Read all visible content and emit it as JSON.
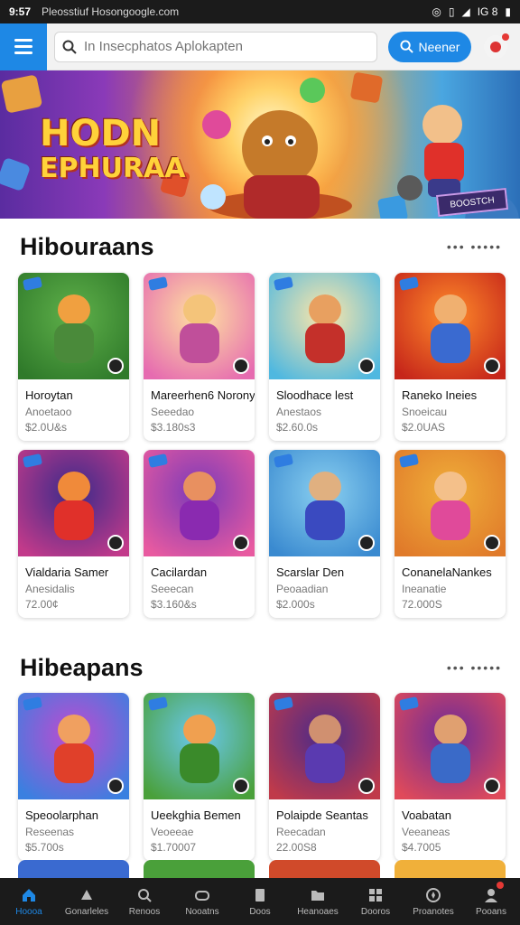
{
  "status_bar": {
    "time": "9:57",
    "url": "Pleosstiuf Hosongoogle.com",
    "indicators": "IG 8"
  },
  "top_bar": {
    "search_placeholder": "In Insecphatos Aplokapten",
    "search_button_label": "Neener"
  },
  "hero": {
    "title_line1": "HODN",
    "title_line2": "EPHURAA",
    "sign_text": "BOOSTCH"
  },
  "sections": [
    {
      "title": "Hibouraans",
      "more": "••• •••••",
      "cards": [
        {
          "title": "Horoytan",
          "subtitle": "Anoetaoo",
          "price": "$2.0U&s",
          "colors": [
            "#5fb04a",
            "#2f7a2a",
            "#f0a040",
            "#4a8a3a"
          ]
        },
        {
          "title": "Mareerhen6 Norony",
          "subtitle": "Seeedao",
          "price": "$3.180s3",
          "colors": [
            "#ffe3a0",
            "#e66bb0",
            "#f4c47a",
            "#c04f9a"
          ]
        },
        {
          "title": "Sloodhace lest",
          "subtitle": "Anestaos",
          "price": "$2.60.0s",
          "colors": [
            "#ffe7a8",
            "#4fb8e0",
            "#e8a060",
            "#c4302a"
          ]
        },
        {
          "title": "Raneko Ineies",
          "subtitle": "Snoeicau",
          "price": "$2.0UAS",
          "colors": [
            "#ff8c2a",
            "#c6261a",
            "#f0b070",
            "#3a6ad0"
          ]
        }
      ]
    },
    {
      "title": "Hibouraans",
      "more": "",
      "cards": [
        {
          "title": "Vialdaria Samer",
          "subtitle": "Anesidalis",
          "price": "72.00¢",
          "colors": [
            "#3a2a8a",
            "#c23a8a",
            "#f08a3a",
            "#e0302a"
          ]
        },
        {
          "title": "Cacilardan",
          "subtitle": "Seeecan",
          "price": "$3.160&s",
          "colors": [
            "#7a3ab8",
            "#e85aa0",
            "#e89060",
            "#8a2ab0"
          ]
        },
        {
          "title": "Scarslar Den",
          "subtitle": "Peoaadian",
          "price": "$2.000s",
          "colors": [
            "#8ad0f0",
            "#3a8ad0",
            "#e0b080",
            "#3a4ac0"
          ]
        },
        {
          "title": "ConanelaNankes",
          "subtitle": "Ineanatie",
          "price": "72.000S",
          "colors": [
            "#f0b03a",
            "#e07a2a",
            "#f4c08a",
            "#e04a9a"
          ]
        }
      ]
    },
    {
      "title": "Hibeapans",
      "more": "••• •••••",
      "cards": [
        {
          "title": "Speoolarphan",
          "subtitle": "Reseenas",
          "price": "$5.700s",
          "colors": [
            "#c04ad0",
            "#3a80e0",
            "#f0a060",
            "#e0402a"
          ]
        },
        {
          "title": "Ueekghia Bemen",
          "subtitle": "Veoeeae",
          "price": "$1.70007",
          "colors": [
            "#6ac8f0",
            "#4aa03a",
            "#f0a050",
            "#3a8a2a"
          ]
        },
        {
          "title": "Polaipde Seantas",
          "subtitle": "Reecadan",
          "price": "22.00S8",
          "colors": [
            "#4a2a8a",
            "#c03a4a",
            "#d09070",
            "#5a3ab0"
          ]
        },
        {
          "title": "Voabatan",
          "subtitle": "Veeaneas",
          "price": "$4.7005",
          "colors": [
            "#6a2a9a",
            "#e04a5a",
            "#e0a070",
            "#3a6ac8"
          ]
        }
      ]
    }
  ],
  "partial_row_colors": [
    "#3a6ad0",
    "#4aa03a",
    "#d04a2a",
    "#f0b03a"
  ],
  "bottom_nav": [
    {
      "label": "Hoooa",
      "icon": "home-icon"
    },
    {
      "label": "Gonarleles",
      "icon": "categories-icon"
    },
    {
      "label": "Renoos",
      "icon": "search-icon"
    },
    {
      "label": "Nooatns",
      "icon": "gamepad-icon"
    },
    {
      "label": "Doos",
      "icon": "docs-icon"
    },
    {
      "label": "Heanoaes",
      "icon": "folder-icon"
    },
    {
      "label": "Dooros",
      "icon": "grid-icon"
    },
    {
      "label": "Proanotes",
      "icon": "compass-icon"
    },
    {
      "label": "Pooans",
      "icon": "profile-icon"
    }
  ],
  "colors": {
    "accent": "#1e88e5",
    "nav_bg": "#1b1b1b"
  }
}
